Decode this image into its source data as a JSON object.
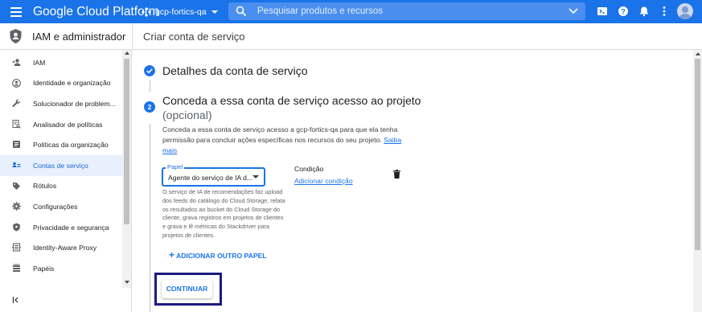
{
  "topbar": {
    "app_title": "Google Cloud Platform",
    "project": "gcp-fortics-qa",
    "search_placeholder": "Pesquisar produtos e recursos"
  },
  "header": {
    "section_title": "IAM e administrador",
    "page_title": "Criar conta de serviço"
  },
  "sidebar": {
    "items": [
      {
        "label": "IAM",
        "icon": "person-add-icon",
        "active": false
      },
      {
        "label": "Identidade e organização",
        "icon": "account-circle-icon",
        "active": false
      },
      {
        "label": "Solucionador de problem...",
        "icon": "wrench-icon",
        "active": false
      },
      {
        "label": "Analisador de políticas",
        "icon": "policy-search-icon",
        "active": false
      },
      {
        "label": "Políticas da organização",
        "icon": "document-list-icon",
        "active": false
      },
      {
        "label": "Contas de serviço",
        "icon": "service-account-icon",
        "active": true
      },
      {
        "label": "Rótulos",
        "icon": "label-tag-icon",
        "active": false
      },
      {
        "label": "Configurações",
        "icon": "gear-icon",
        "active": false
      },
      {
        "label": "Privacidade e segurança",
        "icon": "security-shield-icon",
        "active": false
      },
      {
        "label": "Identity-Aware Proxy",
        "icon": "proxy-icon",
        "active": false
      },
      {
        "label": "Papéis",
        "icon": "roles-icon",
        "active": false
      }
    ],
    "collapse_label": "<|"
  },
  "steps": {
    "step1_title": "Detalhes da conta de serviço",
    "step2_number": "2",
    "step2_title": "Conceda a essa conta de serviço acesso ao projeto",
    "step2_subtitle": "(opcional)",
    "description": "Conceda a essa conta de serviço acesso a gcp-fortics-qa para que ela tenha permissão para concluir ações específicas nos recursos do seu projeto.",
    "learn_more": "Saiba mais"
  },
  "role": {
    "label": "Papel",
    "value": "Agente do serviço de IA d...",
    "help": "O serviço de IA de recomendações faz upload dos feeds do catálogo do Cloud Storage, relata os resultados ao bucket do Cloud Storage do cliente, grava registros em projetos de clientes e grava e lê métricas do Stackdriver para projetos de clientes."
  },
  "condition": {
    "title": "Condição",
    "add_link": "Adicionar condição"
  },
  "actions": {
    "add_role": "ADICIONAR OUTRO PAPEL",
    "continue": "CONTINUAR"
  },
  "colors": {
    "brand_blue": "#1a73e8",
    "highlight_frame": "#1a1a80",
    "active_nav_bg": "#e8f0fe"
  }
}
